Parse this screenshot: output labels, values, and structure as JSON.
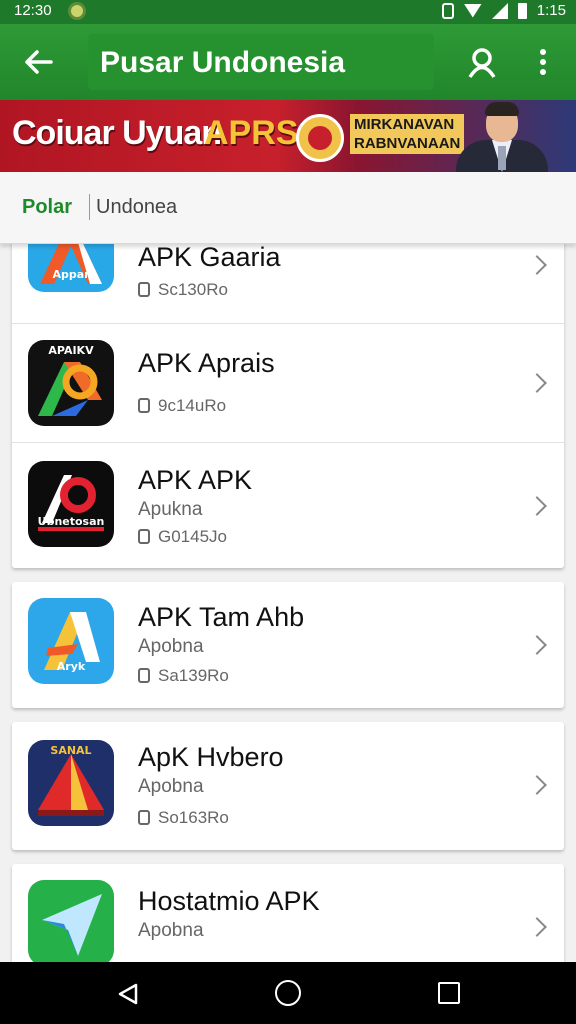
{
  "status_bar": {
    "time": "12:30",
    "clock": "1:15"
  },
  "app_bar": {
    "title": "Pusar Undonesia"
  },
  "banner": {
    "title": "Coiuar Uyuan",
    "highlight": "APRS",
    "sub_line1": "MIRKANAVAN",
    "sub_line2": "RABNVANAAN"
  },
  "tabs": {
    "active": "Polar",
    "inactive": "Undonea"
  },
  "apps": [
    {
      "name": "APK Gaaria",
      "publisher": "",
      "meta": "Sc130Ro",
      "icon_label": "Appar",
      "icon": "stylized-a-icon"
    },
    {
      "name": "APK Aprais",
      "publisher": "",
      "meta": "9c14uRo",
      "icon_label": "APAIKV",
      "icon": "stylized-p-icon"
    },
    {
      "name": "APK APK",
      "publisher": "Apukna",
      "meta": "G0145Jo",
      "icon_label": "Ubnetosan",
      "icon": "stylized-ap-icon"
    },
    {
      "name": "APK Tam Ahb",
      "publisher": "Apobna",
      "meta": "Sa139Ro",
      "icon_label": "Aryk",
      "icon": "stylized-a-icon"
    },
    {
      "name": "ApK Hvbero",
      "publisher": "Apobna",
      "meta": "So163Ro",
      "icon_label": "SANAL",
      "icon": "tent-icon"
    },
    {
      "name": "Hostatmio APK",
      "publisher": "Apobna",
      "meta": "",
      "icon_label": "",
      "icon": "paper-plane-icon"
    }
  ],
  "colors": {
    "primary": "#21862b",
    "accent_text": "#1e8a2c",
    "banner_red": "#c7202c",
    "banner_gold": "#f5c436"
  }
}
